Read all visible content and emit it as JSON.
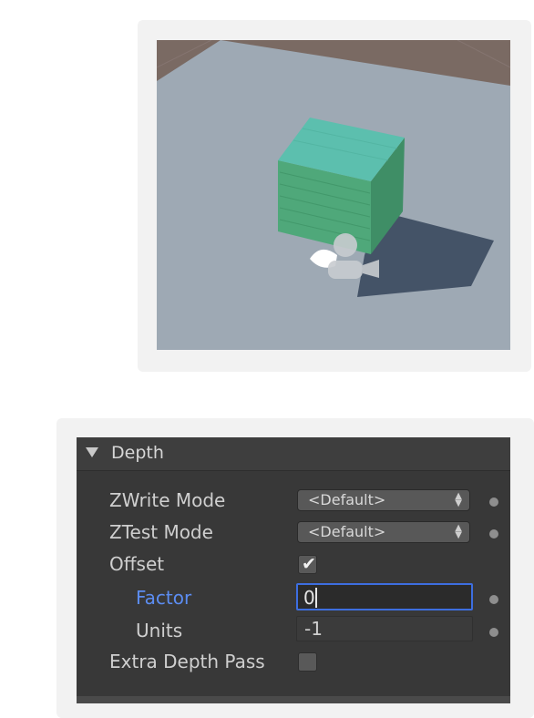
{
  "scene_view": {
    "object": "cube",
    "icons": [
      "light-gizmo-icon",
      "camera-gizmo-icon"
    ]
  },
  "inspector": {
    "section_title": "Depth",
    "fields": {
      "zwrite_mode": {
        "label": "ZWrite Mode",
        "value": "<Default>"
      },
      "ztest_mode": {
        "label": "ZTest Mode",
        "value": "<Default>"
      },
      "offset": {
        "label": "Offset",
        "checked": true
      },
      "factor": {
        "label": "Factor",
        "value": "0"
      },
      "units": {
        "label": "Units",
        "value": "-1"
      },
      "extra_depth_pass": {
        "label": "Extra Depth Pass",
        "checked": false
      }
    },
    "checkmark_glyph": "✔",
    "dropdown_arrows": "▲▼"
  },
  "colors": {
    "inspector_bg": "#383838",
    "active_label": "#5c8df2",
    "focus_border": "#3d6ee0",
    "cube_top": "#5cb8a6",
    "cube_side": "#4aa070"
  }
}
